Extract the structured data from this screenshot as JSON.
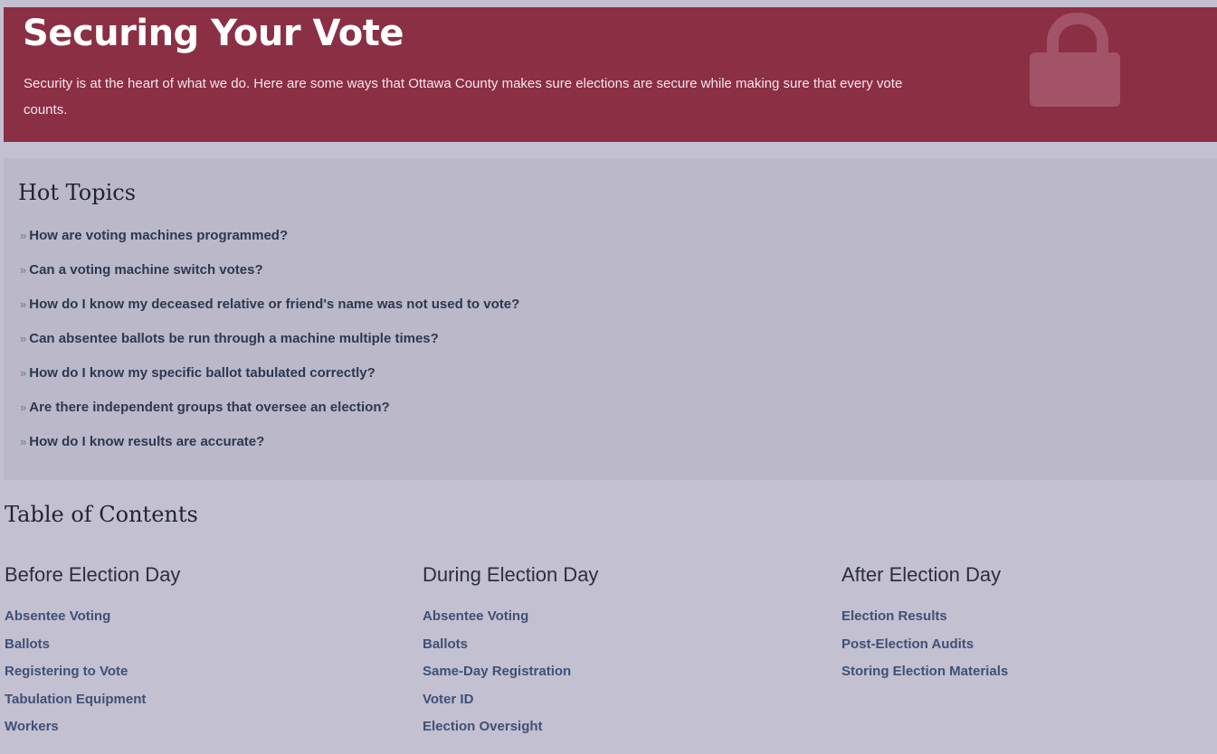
{
  "banner": {
    "title": "Securing Your Vote",
    "text": "Security is at the heart of what we do. Here are some ways that Ottawa County makes sure elections are secure while making sure that every vote counts.",
    "icon": "lock-icon",
    "color": "#8b2f45"
  },
  "hot_topics": {
    "title": "Hot Topics",
    "bullet": "»",
    "items": [
      "How are voting machines programmed?",
      "Can a voting machine switch votes?",
      "How do I know my deceased relative or friend's name was not used to vote?",
      "Can absentee ballots be run through a machine multiple times?",
      "How do I know my specific ballot tabulated correctly?",
      "Are there independent groups that oversee an election?",
      "How do I know results are accurate?"
    ]
  },
  "toc": {
    "title": "Table of Contents",
    "columns": [
      {
        "heading": "Before Election Day",
        "links": [
          "Absentee Voting",
          "Ballots",
          "Registering to Vote",
          "Tabulation Equipment",
          "Workers"
        ]
      },
      {
        "heading": "During Election Day",
        "links": [
          "Absentee Voting",
          "Ballots",
          "Same-Day Registration",
          "Voter ID",
          "Election Oversight"
        ]
      },
      {
        "heading": "After Election Day",
        "links": [
          "Election Results",
          "Post-Election Audits",
          "Storing Election Materials"
        ]
      }
    ]
  }
}
